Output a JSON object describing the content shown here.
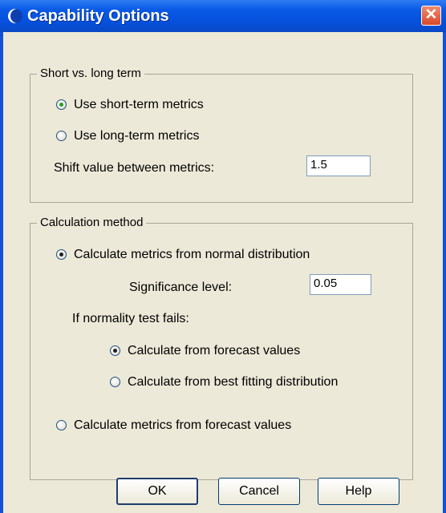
{
  "window": {
    "title": "Capability Options",
    "close_glyph": "✕",
    "app_icon": "app-icon"
  },
  "term_group": {
    "legend": "Short vs. long term",
    "short_term": {
      "label": "Use short-term metrics",
      "checked": true
    },
    "long_term": {
      "label": "Use long-term metrics",
      "checked": false
    },
    "shift_label": "Shift value between metrics:",
    "shift_value": "1.5"
  },
  "calc_group": {
    "legend": "Calculation method",
    "normal_dist": {
      "label": "Calculate metrics from normal distribution",
      "checked": true
    },
    "significance_label": "Significance level:",
    "significance_value": "0.05",
    "normality_label": "If normality test fails:",
    "from_forecast": {
      "label": "Calculate from forecast values",
      "checked": true
    },
    "best_fitting": {
      "label": "Calculate from best fitting distribution",
      "checked": false
    },
    "metrics_forecast": {
      "label": "Calculate metrics from forecast values",
      "checked": false
    }
  },
  "buttons": {
    "ok": "OK",
    "cancel": "Cancel",
    "help": "Help"
  }
}
